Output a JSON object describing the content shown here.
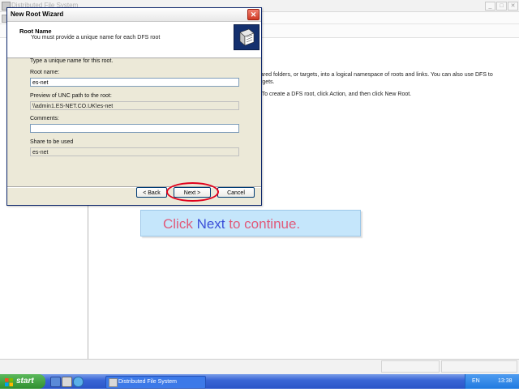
{
  "background_window": {
    "title": "Distributed File System",
    "content_line_1": "ared folders, or targets, into a logical namespace of roots and links. You can also use DFS to",
    "content_line_2": "rgets.",
    "content_line_3": "t. To create a DFS root, click Action, and then click New Root."
  },
  "dialog": {
    "title": "New Root Wizard",
    "close_label": "✕",
    "header_title": "Root Name",
    "header_subtitle": "You must provide a unique name for each DFS root",
    "instruction": "Type a unique name for this root.",
    "root_name_label": "Root name:",
    "root_name_value": "es-net",
    "unc_preview_label": "Preview of UNC path to the root:",
    "unc_preview_value": "\\\\admin1.ES-NET.CO.UK\\es-net",
    "comments_label": "Comments:",
    "comments_value": "",
    "share_label": "Share to be used",
    "share_value": "es-net",
    "back_button": "< Back",
    "next_button": "Next >",
    "cancel_button": "Cancel"
  },
  "tooltip": {
    "part1": "Click ",
    "part2": "Next",
    "part3": " to continue.",
    "color_main": "#e05a7a",
    "color_highlight": "#3b4fd8"
  },
  "taskbar": {
    "start_label": "start",
    "task_label": "Distributed File System",
    "language": "EN",
    "clock": "13:38"
  },
  "colors": {
    "annotation": "#e0001c",
    "taskbar": "#2a55c8",
    "start_button": "#2f8f2f"
  }
}
